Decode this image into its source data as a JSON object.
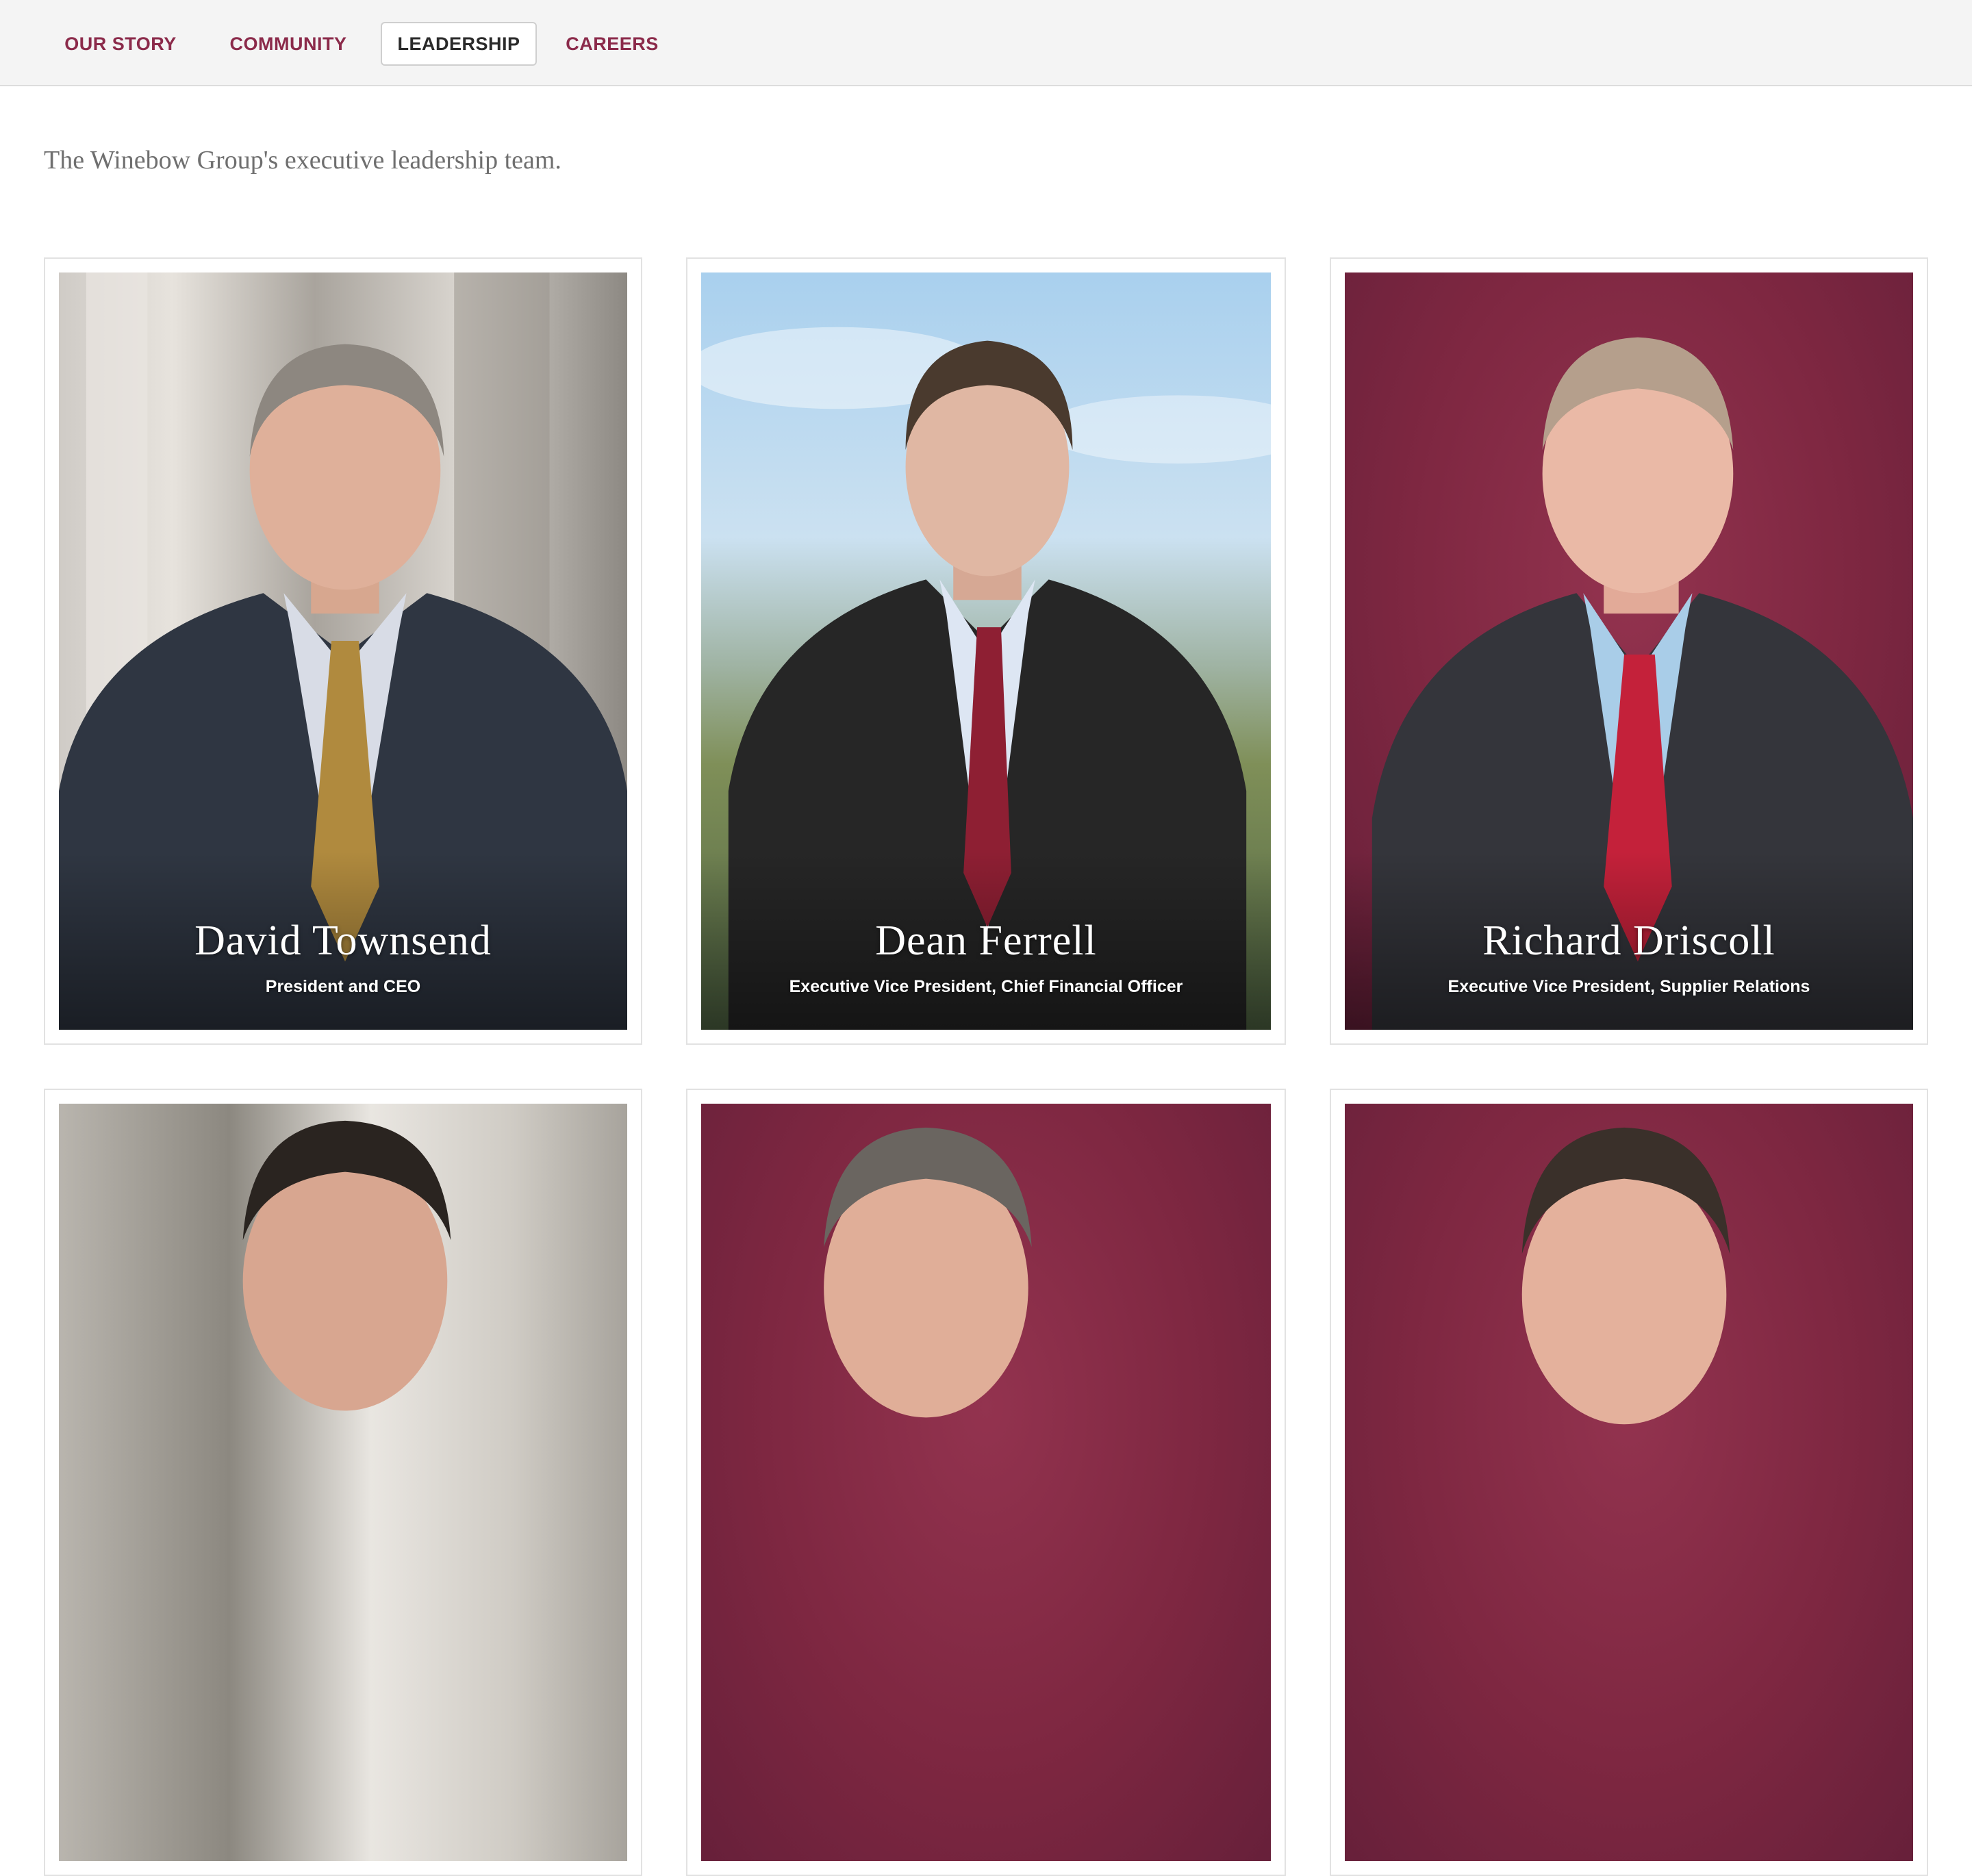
{
  "nav": {
    "items": [
      {
        "label": "OUR STORY",
        "active": false
      },
      {
        "label": "COMMUNITY",
        "active": false
      },
      {
        "label": "LEADERSHIP",
        "active": true
      },
      {
        "label": "CAREERS",
        "active": false
      }
    ]
  },
  "intro": "The Winebow Group's executive leadership team.",
  "leaders": [
    {
      "name": "David Townsend",
      "title": "President and CEO",
      "tie_color": "#b08a3e",
      "background": "office window"
    },
    {
      "name": "Dean Ferrell",
      "title": "Executive Vice President, Chief Financial Officer",
      "tie_color": "#8e1f33",
      "background": "sky and trees"
    },
    {
      "name": "Richard Driscoll",
      "title": "Executive Vice President, Supplier Relations",
      "tie_color": "#c4213a",
      "background": "wine red"
    },
    {
      "name": "",
      "title": "",
      "background": "office window"
    },
    {
      "name": "",
      "title": "",
      "background": "wine red"
    },
    {
      "name": "",
      "title": "",
      "background": "wine red"
    }
  ],
  "colors": {
    "accent": "#8b2a4a",
    "nav_background": "#f4f4f4",
    "intro_text": "#6f6f6f"
  }
}
